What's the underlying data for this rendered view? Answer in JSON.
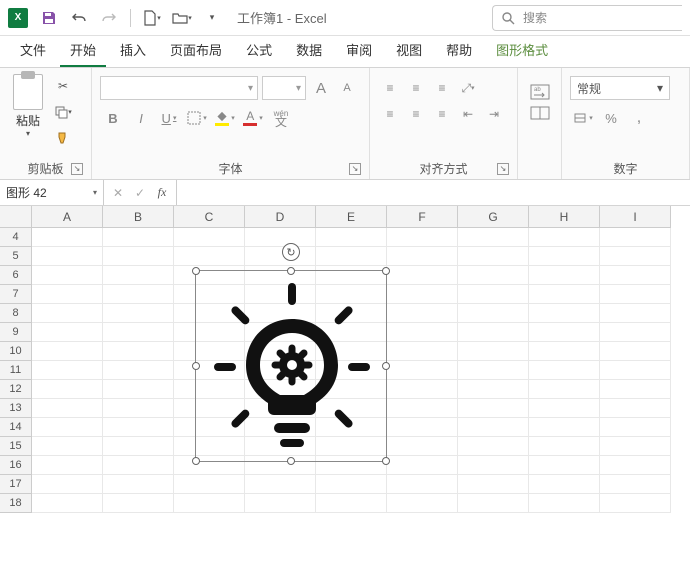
{
  "titlebar": {
    "doc_title": "工作簿1",
    "app_name": "Excel",
    "title_sep": " - ",
    "search_placeholder": "搜索"
  },
  "tabs": {
    "file": "文件",
    "home": "开始",
    "insert": "插入",
    "layout": "页面布局",
    "formulas": "公式",
    "data": "数据",
    "review": "审阅",
    "view": "视图",
    "help": "帮助",
    "shape_format": "图形格式"
  },
  "ribbon": {
    "clipboard": {
      "paste": "粘贴",
      "label": "剪贴板"
    },
    "font": {
      "label": "字体",
      "bold": "B",
      "italic": "I",
      "underline": "U",
      "wen": "wén 文",
      "size_up": "A",
      "size_down": "A"
    },
    "align": {
      "label": "对齐方式"
    },
    "number": {
      "label": "数字",
      "format": "常规",
      "percent": "%",
      "comma": ","
    }
  },
  "fxbar": {
    "namebox_value": "图形 42",
    "cancel": "✕",
    "enter": "✓",
    "fx": "fx"
  },
  "grid": {
    "cols": [
      "A",
      "B",
      "C",
      "D",
      "E",
      "F",
      "G",
      "H",
      "I"
    ],
    "rows": [
      "4",
      "5",
      "6",
      "7",
      "8",
      "9",
      "10",
      "11",
      "12",
      "13",
      "14",
      "15",
      "16",
      "17",
      "18"
    ]
  }
}
